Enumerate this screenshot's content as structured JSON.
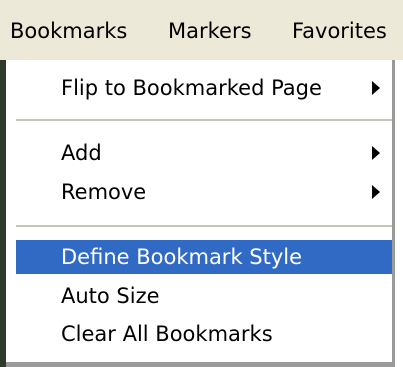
{
  "menubar": {
    "items": [
      {
        "label": "Bookmarks"
      },
      {
        "label": "Markers"
      },
      {
        "label": "Favorites"
      }
    ]
  },
  "dropdown": {
    "items": [
      {
        "label": "Flip to Bookmarked Page",
        "has_submenu": true
      },
      {
        "label": "Add",
        "has_submenu": true
      },
      {
        "label": "Remove",
        "has_submenu": true
      },
      {
        "label": "Define Bookmark Style",
        "selected": true
      },
      {
        "label": "Auto Size"
      },
      {
        "label": "Clear All Bookmarks"
      }
    ]
  },
  "colors": {
    "menubar_background": "#ece9d8",
    "selection_background": "#316ac5",
    "selection_text": "#ffffff"
  }
}
